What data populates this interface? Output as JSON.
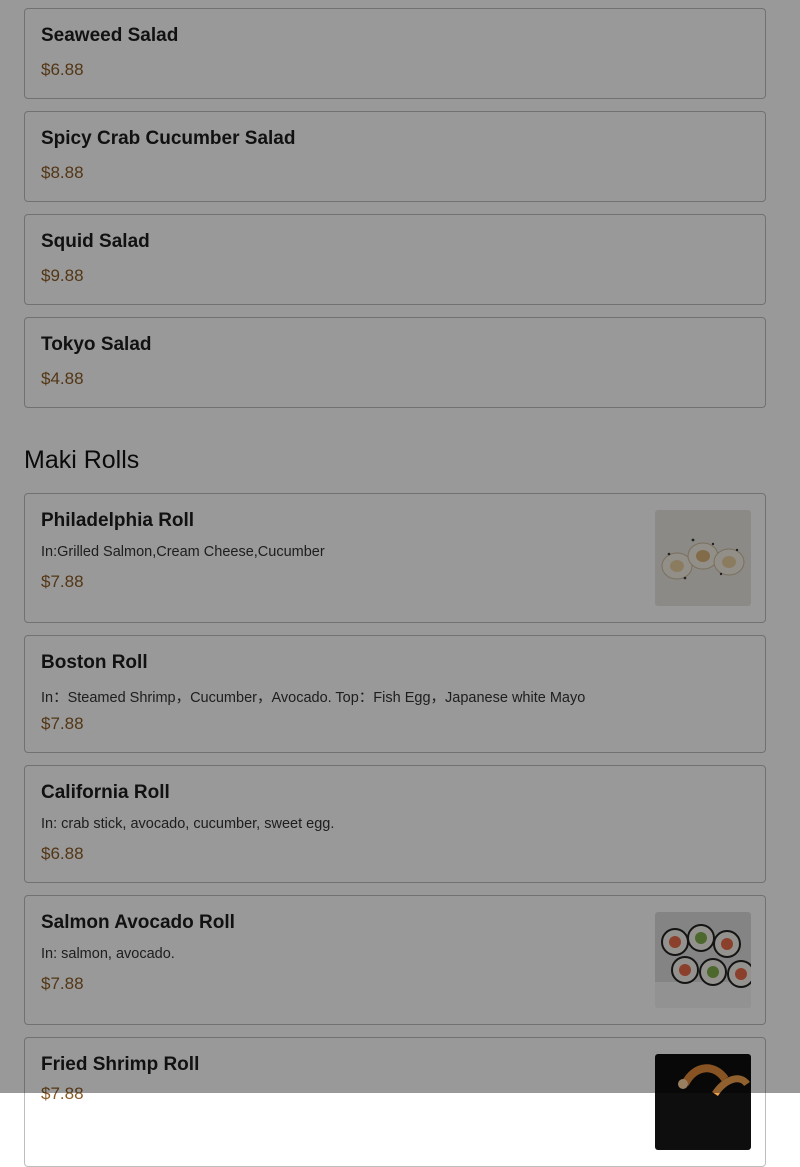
{
  "salads": [
    {
      "name": "Seaweed Salad",
      "price": "$6.88"
    },
    {
      "name": "Spicy Crab Cucumber Salad",
      "price": "$8.88"
    },
    {
      "name": "Squid Salad",
      "price": "$9.88"
    },
    {
      "name": "Tokyo Salad",
      "price": "$4.88"
    }
  ],
  "maki_section": {
    "title": "Maki Rolls",
    "items": [
      {
        "name": "Philadelphia Roll",
        "description": "In:Grilled Salmon,Cream Cheese,Cucumber",
        "price": "$7.88",
        "image_icon": "philadelphia-roll-photo"
      },
      {
        "name": "Boston Roll",
        "description": "In：Steamed Shrimp，Cucumber，Avocado. Top：Fish Egg，Japanese white Mayo",
        "price": "$7.88"
      },
      {
        "name": "California Roll",
        "description": "In: crab stick, avocado, cucumber, sweet egg.",
        "price": "$6.88"
      },
      {
        "name": "Salmon Avocado Roll",
        "description": "In: salmon, avocado.",
        "price": "$7.88",
        "image_icon": "salmon-avocado-roll-photo"
      },
      {
        "name": "Fried Shrimp Roll",
        "price": "$7.88",
        "image_icon": "fried-shrimp-roll-photo"
      }
    ]
  },
  "colors": {
    "price": "#8a5a24",
    "overlay": "rgba(0,0,0,0.4)"
  }
}
